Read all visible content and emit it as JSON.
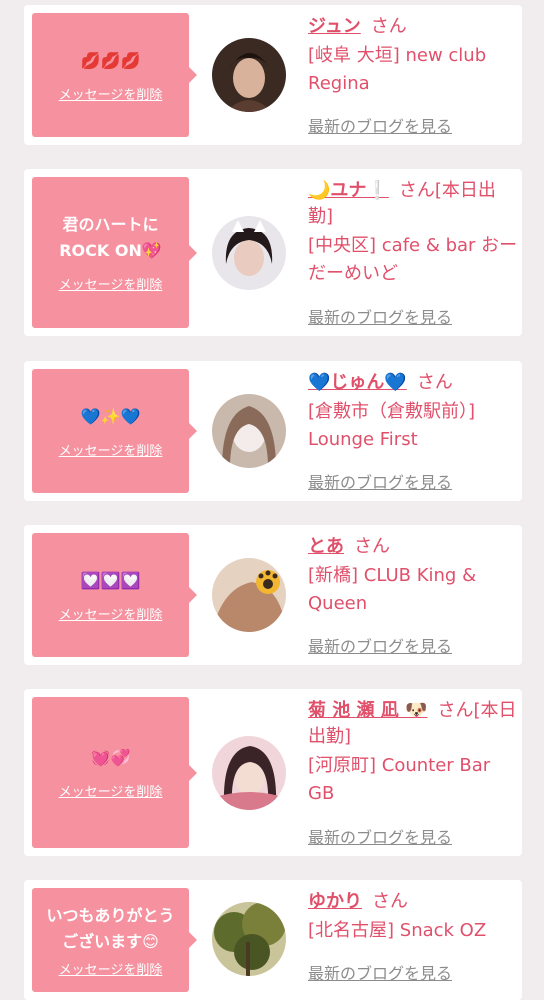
{
  "colors": {
    "page_bg": "#f1ecee",
    "bubble": "#f6919f",
    "accent_text": "#e0506b",
    "link_gray": "#8c8c8c"
  },
  "delete_label": "メッセージを削除",
  "blog_label": "最新のブログを見る",
  "honorific": "さん",
  "cards": [
    {
      "message": "💋💋💋",
      "name": "ジュン",
      "name_suffix": "さん",
      "club": "[岐阜 大垣] new club Regina",
      "avatar_icon": "avatar-photo-dark-hair-woman"
    },
    {
      "message": "君のハートに\nROCK ON💖",
      "name": "🌙ユナ❕",
      "name_suffix": "さん[本日出勤]",
      "club": "[中央区] cafe & bar おーだーめいど",
      "avatar_icon": "avatar-photo-cat-ears-filter"
    },
    {
      "message": "💙✨💙",
      "name": "💙じゅん💙",
      "name_suffix": "さん",
      "club": "[倉敷市（倉敷駅前）] Lounge First",
      "avatar_icon": "avatar-photo-blurred-face"
    },
    {
      "message": "💟💟💟",
      "name": "とあ",
      "name_suffix": "さん",
      "club": "[新橋] CLUB King & Queen",
      "avatar_icon": "avatar-photo-paw-sticker"
    },
    {
      "message": "💓💞",
      "name": "菊 池 瀬 凪 🐶",
      "name_suffix": "さん[本日出勤]",
      "club": "[河原町] Counter Bar GB",
      "avatar_icon": "avatar-photo-pink-hair-woman"
    },
    {
      "message": "いつもありがとう\nございます😊",
      "name": "ゆかり",
      "name_suffix": "さん",
      "club": "[北名古屋] Snack OZ",
      "avatar_icon": "avatar-photo-trees"
    }
  ]
}
